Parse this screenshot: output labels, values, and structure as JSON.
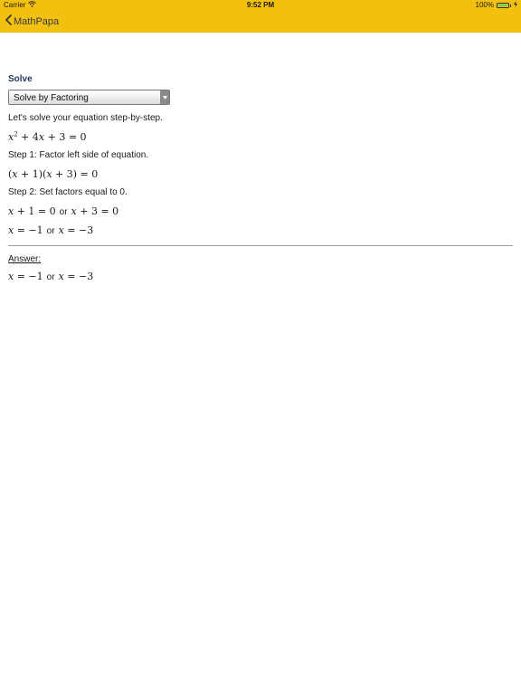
{
  "status_bar": {
    "carrier": "Carrier",
    "time": "9:52 PM",
    "battery": "100%"
  },
  "nav": {
    "back_label": "MathPapa",
    "color": "#f2c10f"
  },
  "solve": {
    "heading": "Solve",
    "method": "Solve by Factoring",
    "intro": "Let's solve your equation step-by-step.",
    "equation": "x2 + 4x + 3 = 0",
    "step1": "Step 1: Factor left side of equation.",
    "factored": "(x + 1)(x + 3) = 0",
    "step2": "Step 2: Set factors equal to 0.",
    "factors_left": "x + 1 = 0",
    "factors_right": "x + 3 = 0",
    "roots_left": "x = −1",
    "roots_right": "x = −3",
    "or": "or"
  },
  "answer": {
    "heading": "Answer:",
    "left": "x = −1",
    "right": "x = −3",
    "or": "or"
  }
}
